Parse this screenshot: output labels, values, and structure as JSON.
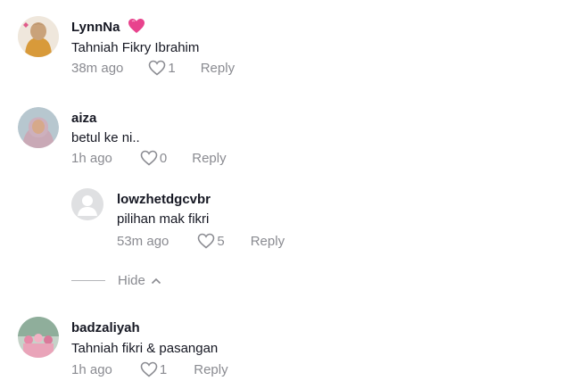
{
  "colors": {
    "primary_text": "#161823",
    "secondary_text": "#8a8b91",
    "heart_emoji": "#e8438d"
  },
  "comments": [
    {
      "username": "LynnNa",
      "badge_icon": "pink-heart-emoji-icon",
      "text": "Tahniah Fikry Ibrahim",
      "time": "38m ago",
      "likes": "1",
      "reply_label": "Reply"
    },
    {
      "username": "aiza",
      "text": "betul ke ni..",
      "time": "1h ago",
      "likes": "0",
      "reply_label": "Reply",
      "replies": [
        {
          "username": "lowzhetdgcvbr",
          "text": "pilihan mak fikri",
          "time": "53m ago",
          "likes": "5",
          "reply_label": "Reply"
        }
      ],
      "hide_label": "Hide"
    },
    {
      "username": "badzaliyah",
      "text": "Tahniah fikri & pasangan",
      "time": "1h ago",
      "likes": "1",
      "reply_label": "Reply"
    }
  ]
}
